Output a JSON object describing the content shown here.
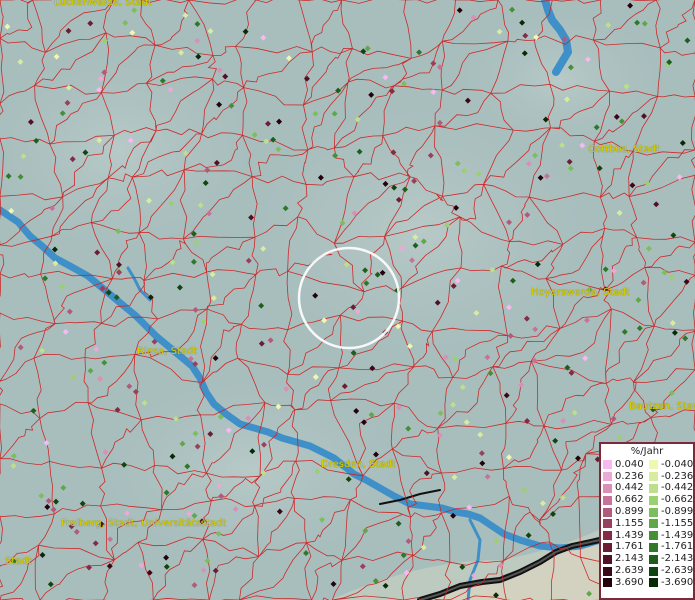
{
  "legend": {
    "title": "%/Jahr",
    "positive": [
      {
        "label": "0.040",
        "color": "#f8b8f0"
      },
      {
        "label": "0.236",
        "color": "#eca8d6"
      },
      {
        "label": "0.442",
        "color": "#d98fb8"
      },
      {
        "label": "0.662",
        "color": "#c77399"
      },
      {
        "label": "0.899",
        "color": "#b25a7c"
      },
      {
        "label": "1.155",
        "color": "#9a405f"
      },
      {
        "label": "1.439",
        "color": "#832b47"
      },
      {
        "label": "1.761",
        "color": "#6c1c33"
      },
      {
        "label": "2.143",
        "color": "#521024"
      },
      {
        "label": "2.639",
        "color": "#3a0716"
      },
      {
        "label": "3.690",
        "color": "#23020c"
      }
    ],
    "negative": [
      {
        "label": "-0.040",
        "color": "#f0f8b0"
      },
      {
        "label": "-0.236",
        "color": "#d8eca0"
      },
      {
        "label": "-0.442",
        "color": "#bce08a"
      },
      {
        "label": "-0.662",
        "color": "#9ccf72"
      },
      {
        "label": "-0.899",
        "color": "#7cbd5c"
      },
      {
        "label": "-1.155",
        "color": "#5ea848"
      },
      {
        "label": "-1.439",
        "color": "#449036"
      },
      {
        "label": "-1.761",
        "color": "#2e7828"
      },
      {
        "label": "-2.143",
        "color": "#1e5e1c"
      },
      {
        "label": "-2.639",
        "color": "#104410"
      },
      {
        "label": "-3.690",
        "color": "#062a06"
      }
    ]
  },
  "places": {
    "luckenwalde": "Luckenwalde, Stadt",
    "cottbus": "Cottbus, Stadt",
    "hoyerswerda": "Hoyerswerda, Stadt",
    "riesa": "Riesa, Stadt",
    "bautzen": "Bautzen, Stadt",
    "dresden": "Dresden, Stadt",
    "freiberg": "Freiberg, Stadt, Universitätsstadt",
    "stadt_left": "Stadt"
  },
  "colors": {
    "background": "#a7bdbc",
    "borders": "#cc2222",
    "river": "#3f8fc8",
    "place_label": "#d8d000",
    "highlight_ring": "#ffffff"
  }
}
